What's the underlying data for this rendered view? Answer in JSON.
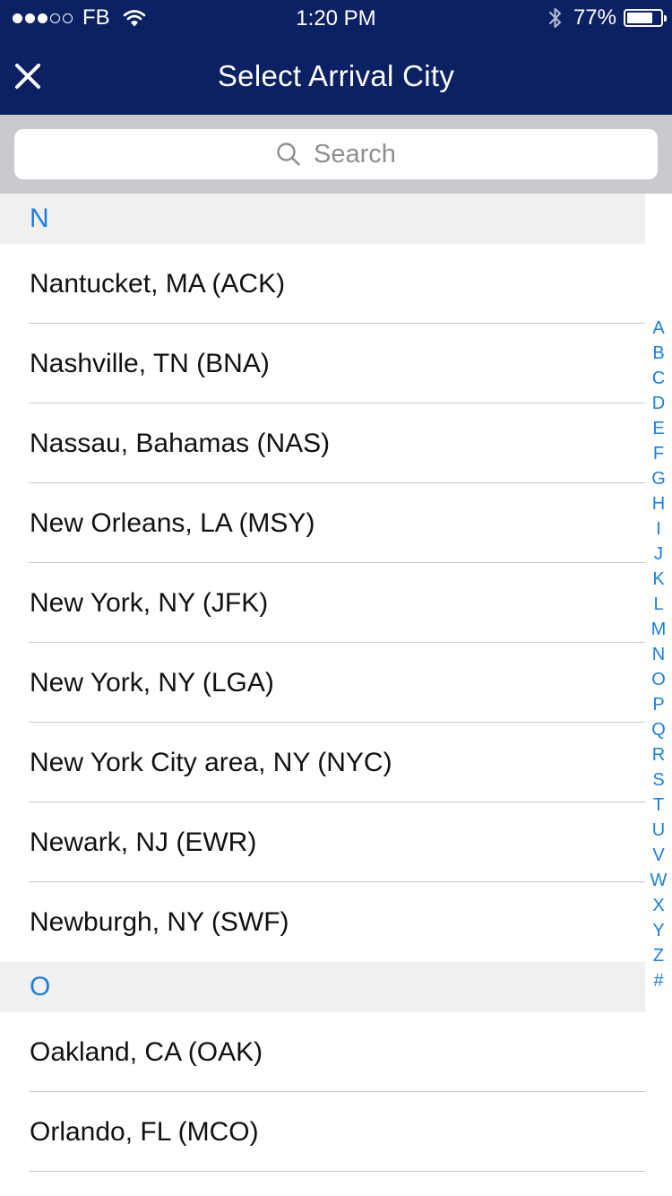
{
  "status_bar": {
    "carrier": "FB",
    "time": "1:20 PM",
    "battery_percent": "77%",
    "battery_level": 0.77,
    "signal_bars_filled": 3,
    "signal_bars_total": 5
  },
  "nav": {
    "title": "Select Arrival City"
  },
  "search": {
    "placeholder": "Search"
  },
  "sections": [
    {
      "letter": "N",
      "cities": [
        "Nantucket, MA (ACK)",
        "Nashville, TN (BNA)",
        "Nassau, Bahamas (NAS)",
        "New Orleans, LA (MSY)",
        "New York, NY (JFK)",
        "New York, NY (LGA)",
        "New York City area, NY (NYC)",
        "Newark, NJ (EWR)",
        "Newburgh, NY (SWF)"
      ]
    },
    {
      "letter": "O",
      "cities": [
        "Oakland, CA (OAK)",
        "Orlando, FL (MCO)"
      ]
    }
  ],
  "index_letters": [
    "A",
    "B",
    "C",
    "D",
    "E",
    "F",
    "G",
    "H",
    "I",
    "J",
    "K",
    "L",
    "M",
    "N",
    "O",
    "P",
    "Q",
    "R",
    "S",
    "T",
    "U",
    "V",
    "W",
    "X",
    "Y",
    "Z",
    "#"
  ],
  "colors": {
    "nav_background": "#0b2163",
    "accent": "#1a7fe0",
    "search_background": "#c9c9ce",
    "section_header_background": "#f0f0f0"
  }
}
